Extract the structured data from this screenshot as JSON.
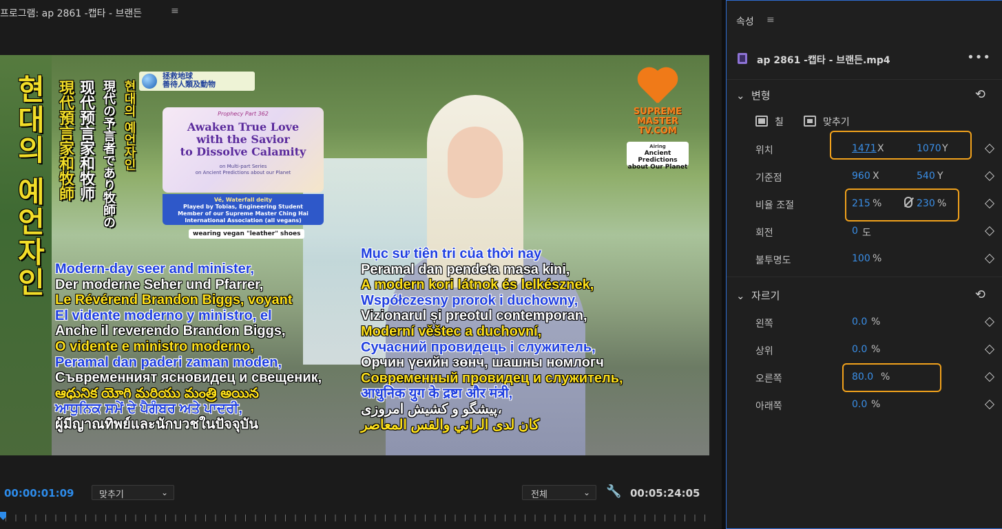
{
  "program": {
    "title": "프로그램: ap 2861 -캡타 - 브랜든",
    "menu_icon": "≡",
    "timecode_current": "00:00:01:09",
    "fit_select": "맞추기",
    "full_select": "전체",
    "wrench_icon": "wrench-icon",
    "timecode_total": "00:05:24:05"
  },
  "video": {
    "vertical_titles": [
      "현대의 예언자인",
      "現代預言家和牧師",
      "现代预言家和牧师",
      "現代の予言者であり牧師の",
      "현대의 예언자인"
    ],
    "badge": [
      "拯救地球",
      "善待人類及動物"
    ],
    "title_card": {
      "part": "Prophecy Part 362",
      "main": [
        "Awaken True Love",
        "with the Savior",
        "to Dissolve Calamity"
      ],
      "series": [
        "on Multi-part Series",
        "on Ancient Predictions about our Planet"
      ]
    },
    "info_card": [
      "Vé, Waterfall deity",
      "Played by Tobias, Engineering Student",
      "Member of our Supreme Master Ching Hai",
      "International Association (all vegans)"
    ],
    "shoes_pill": "wearing vegan \"leather\" shoes",
    "logo_text": [
      "SUPREME MASTER",
      "TV.COM"
    ],
    "airing": [
      "Airing",
      "Ancient Predictions",
      "about Our Planet"
    ],
    "subtitles_left": [
      {
        "text": "Modern-day seer and minister,",
        "color": "blue"
      },
      {
        "text": "Der moderne Seher und Pfarrer,",
        "color": "white"
      },
      {
        "text": "Le Révérend Brandon Biggs, voyant",
        "color": "yellow"
      },
      {
        "text": "El vidente moderno y ministro, el",
        "color": "blue"
      },
      {
        "text": "Anche il reverendo Brandon Biggs,",
        "color": "white"
      },
      {
        "text": "O vidente e ministro moderno,",
        "color": "yellow"
      },
      {
        "text": "Peramal dan paderi zaman moden,",
        "color": "blue"
      },
      {
        "text": "Съвременният ясновидец и свещеник,",
        "color": "white"
      },
      {
        "text": "ఆధునిక యోగి మరియు మంత్రి అయిన",
        "color": "yellow"
      },
      {
        "text": "ਆਧੁਨਿਕ ਸਮੇਂ ਦੇ ਪੈਗੰਬਰ ਅਤੇ ਪਾਦਰੀ,",
        "color": "blue"
      },
      {
        "text": "ผู้มีญาณทิพย์และนักบวชในปัจจุบัน",
        "color": "white"
      }
    ],
    "subtitles_right": [
      {
        "text": "Mục sư tiên tri của thời nay",
        "color": "blue"
      },
      {
        "text": "Peramal dan pendeta masa kini,",
        "color": "white"
      },
      {
        "text": "A modern kori látnok és lelkésznek,",
        "color": "yellow"
      },
      {
        "text": "Współczesny prorok i duchowny,",
        "color": "blue"
      },
      {
        "text": "Vizionarul și preotul contemporan,",
        "color": "white"
      },
      {
        "text": "Moderní věštec a duchovní,",
        "color": "yellow"
      },
      {
        "text": "Сучасний провидець і служитель,",
        "color": "blue"
      },
      {
        "text": "Орчин үеийн зөнч, шашны номлогч",
        "color": "white"
      },
      {
        "text": "Современный провидец и служитель,",
        "color": "yellow"
      },
      {
        "text": "आधुनिक युग के द्रष्टा और मंत्री,",
        "color": "blue"
      },
      {
        "text": "پیشگو و کشیش امروزی،",
        "color": "white"
      },
      {
        "text": "كان لدى الرائي والقس المعاصر",
        "color": "yellow"
      }
    ]
  },
  "properties": {
    "header": "속성",
    "menu_icon": "≡",
    "clip_name": "ap 2861 -캡타 - 브랜든.mp4",
    "more_icon": "•••",
    "transform": {
      "title": "변형",
      "fill_label": "칠",
      "fit_label": "맞추기",
      "position": {
        "label": "위치",
        "x": "1471",
        "x_unit": "X",
        "y": "1070",
        "y_unit": "Y"
      },
      "anchor": {
        "label": "기준점",
        "x": "960",
        "x_unit": "X",
        "y": "540",
        "y_unit": "Y"
      },
      "scale": {
        "label": "비율 조절",
        "w": "215",
        "w_unit": "%",
        "h": "230",
        "h_unit": "%"
      },
      "rotation": {
        "label": "회전",
        "value": "0",
        "unit": "도"
      },
      "opacity": {
        "label": "불투명도",
        "value": "100",
        "unit": "%"
      }
    },
    "crop": {
      "title": "자르기",
      "left": {
        "label": "왼쪽",
        "value": "0.0",
        "unit": "%"
      },
      "top": {
        "label": "상위",
        "value": "0.0",
        "unit": "%"
      },
      "right": {
        "label": "오른쪽",
        "value": "80.0",
        "unit": "%"
      },
      "bottom": {
        "label": "아래쪽",
        "value": "0.0",
        "unit": "%"
      }
    },
    "colors": {
      "accent": "#3a8fe8",
      "highlight": "#f2a21c",
      "panel_border": "#2f6fd6"
    }
  }
}
